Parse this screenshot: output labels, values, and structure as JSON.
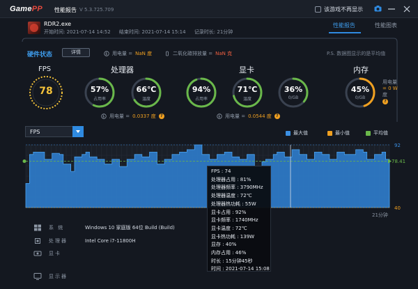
{
  "titlebar": {
    "logo_main": "Game",
    "logo_accent": "PP",
    "title": "性能报告",
    "version": "V 5.3.725.709",
    "checkbox_label": "该游戏不再显示"
  },
  "app": {
    "name": "RDR2.exe",
    "start_label": "开始时间: 2021-07-14 14:52",
    "end_label": "结束时间: 2021-07-14 15:14",
    "duration_label": "记录时长: 21分钟"
  },
  "tabs": [
    {
      "label": "性能报告",
      "active": true
    },
    {
      "label": "性能图表",
      "active": false
    }
  ],
  "hardware": {
    "title": "硬件状态",
    "detail_button": "详情",
    "power_label": "用电量 =",
    "power_value": "NaN 度",
    "co2_label": "二氧化碳排放量 =",
    "co2_value": "NaN 克",
    "note": "P.S. 数据图显示的是平均值"
  },
  "fps": {
    "title": "FPS",
    "value": "78"
  },
  "cpu": {
    "title": "处理器",
    "usage": {
      "value": "57%",
      "label": "占用率",
      "ratio": 0.57
    },
    "temp": {
      "value": "66℃",
      "label": "温度",
      "ratio": 0.66
    },
    "power_label": "用电量 =",
    "power_value": "0.0337 度"
  },
  "gpu": {
    "title": "显卡",
    "usage": {
      "value": "94%",
      "label": "占用率",
      "ratio": 0.94
    },
    "temp": {
      "value": "71℃",
      "label": "温度",
      "ratio": 0.71
    },
    "vram": {
      "value": "36%",
      "label": "0/GB",
      "ratio": 0.36
    },
    "power_label": "用电量 =",
    "power_value": "0.0544 度"
  },
  "memory": {
    "title": "内存",
    "usage": {
      "value": "45%",
      "label": "0/GB",
      "ratio": 0.45
    },
    "power_label": "用电量",
    "power_value": "= 0 W",
    "power_unit": "度"
  },
  "chart_controls": {
    "selected": "FPS",
    "legend": [
      {
        "label": "最大值",
        "color": "#3b8fe3"
      },
      {
        "label": "最小值",
        "color": "#f0a020"
      },
      {
        "label": "平均值",
        "color": "#6ab84a"
      }
    ]
  },
  "chart_data": {
    "type": "area",
    "ylim": [
      40,
      92
    ],
    "ytick_labels": [
      "92",
      "78.41",
      "40"
    ],
    "average": 78.41,
    "xlabel_end": "21分钟",
    "values": [
      60,
      84,
      86,
      86,
      86,
      80,
      80,
      85,
      85,
      84,
      76,
      76,
      70,
      82,
      82,
      84,
      86,
      82,
      82,
      80,
      80,
      76,
      76,
      80,
      80,
      74,
      74,
      80,
      80,
      84,
      84,
      82,
      82,
      86,
      86,
      76,
      76,
      80,
      80,
      84,
      84,
      86,
      86,
      88,
      88,
      92,
      92,
      84,
      84,
      80,
      80,
      84,
      84,
      86,
      86,
      82,
      82,
      80,
      80,
      84,
      84,
      74,
      74,
      78,
      80,
      80,
      84,
      86,
      86,
      82,
      82,
      88,
      88,
      84,
      84,
      80,
      80,
      86,
      86,
      84,
      84,
      80,
      80,
      86,
      86,
      84,
      84,
      84,
      88,
      88,
      86,
      80,
      80,
      84,
      84,
      86,
      80
    ]
  },
  "tooltip": [
    "FPS : 74",
    "处理器占用 : 81%",
    "处理器频率 : 3790MHz",
    "处理器温度 : 72℃",
    "处理器热功耗 : 55W",
    "显卡占用 : 92%",
    "显卡频率 : 1740MHz",
    "显卡温度 : 72℃",
    "显卡热功耗 : 139W",
    "显存 : 40%",
    "内存占用 : 46%",
    "时长 : 15分钟45秒",
    "时间 : 2021-07-14 15:08"
  ],
  "system": [
    {
      "key": "系 统",
      "value": "Windows 10 家庭版 64位  Build (Build)"
    },
    {
      "key": "处理器",
      "value": "Intel Core i7-11800H"
    },
    {
      "key": "显卡",
      "value": ""
    },
    {
      "key": "显示器",
      "value": ""
    }
  ]
}
